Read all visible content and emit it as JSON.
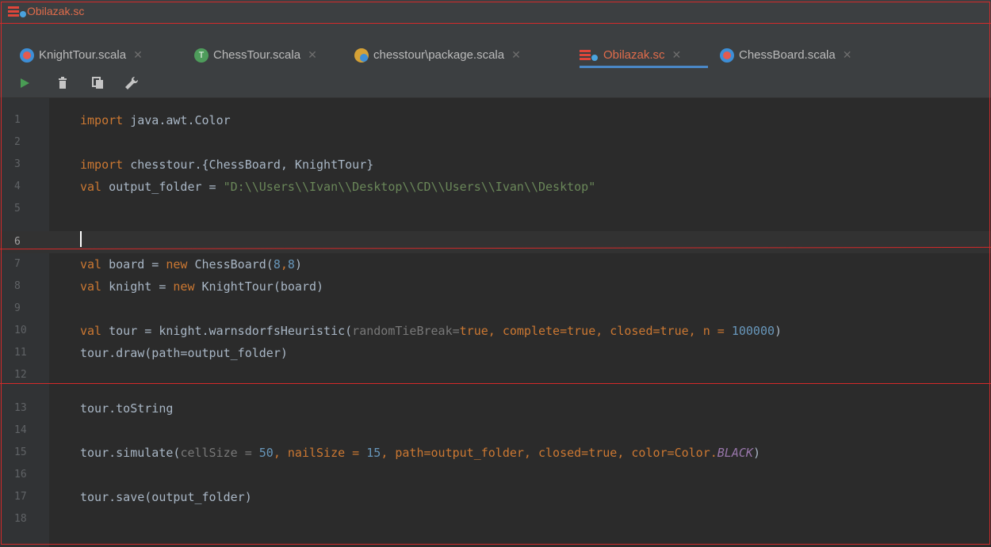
{
  "window": {
    "title": "Obilazak.sc"
  },
  "tabs": [
    {
      "label": "KnightTour.scala",
      "icon": "scala-class-icon"
    },
    {
      "label": "ChessTour.scala",
      "icon": "scala-trait-icon"
    },
    {
      "label": "chesstour\\package.scala",
      "icon": "scala-package-object-icon"
    },
    {
      "label": "Obilazak.sc",
      "icon": "scala-worksheet-icon",
      "active": true
    },
    {
      "label": "ChessBoard.scala",
      "icon": "scala-class-icon"
    }
  ],
  "toolbar": {
    "run": "run-icon",
    "clean": "trash-icon",
    "copy": "copy-icon",
    "settings": "wrench-icon"
  },
  "editor": {
    "line_numbers": [
      "1",
      "2",
      "3",
      "4",
      "5",
      "6",
      "7",
      "8",
      "9",
      "10",
      "11",
      "12",
      "13",
      "14",
      "15",
      "16",
      "17",
      "18"
    ],
    "lines": {
      "l1": {
        "kw": "import",
        "rest": " java.awt.Color"
      },
      "l3": {
        "kw": "import",
        "rest": " chesstour.{ChessBoard, KnightTour}"
      },
      "l4": {
        "kw": "val",
        "rest": " output_folder = ",
        "str": "\"D:\\\\Users\\\\Ivan\\\\Desktop\\\\CD\\\\Users\\\\Ivan\\\\Desktop\""
      },
      "l7": {
        "kw": "val",
        "a": " board = ",
        "kw2": "new",
        "b": " ChessBoard(",
        "n1": "8",
        "c": ",",
        "n2": "8",
        "d": ")"
      },
      "l8": {
        "kw": "val",
        "a": " knight = ",
        "kw2": "new",
        "b": " KnightTour(board)"
      },
      "l10": {
        "kw": "val",
        "a": " tour = knight.warnsdorfsHeuristic(",
        "h1": "randomTieBreak=",
        "t1": "true",
        "b": ", complete=",
        "t2": "true",
        "c": ", closed=",
        "t3": "true",
        "d": ", n = ",
        "n": "100000",
        "e": ")"
      },
      "l11": {
        "text": "tour.draw(path=output_folder)"
      },
      "l13": {
        "text": "tour.toString"
      },
      "l15": {
        "a": "tour.simulate(",
        "h1": "cellSize = ",
        "n1": "50",
        "b": ", nailSize = ",
        "n2": "15",
        "c": ", path=output_folder, closed=",
        "t1": "true",
        "d": ", color=Color.",
        "f": "BLACK",
        "e": ")"
      },
      "l17": {
        "text": "tour.save(output_folder)"
      }
    }
  },
  "colors": {
    "keyword": "#cc7832",
    "string": "#6a8759",
    "number": "#6897bb",
    "annotation": "#d42a2a"
  }
}
